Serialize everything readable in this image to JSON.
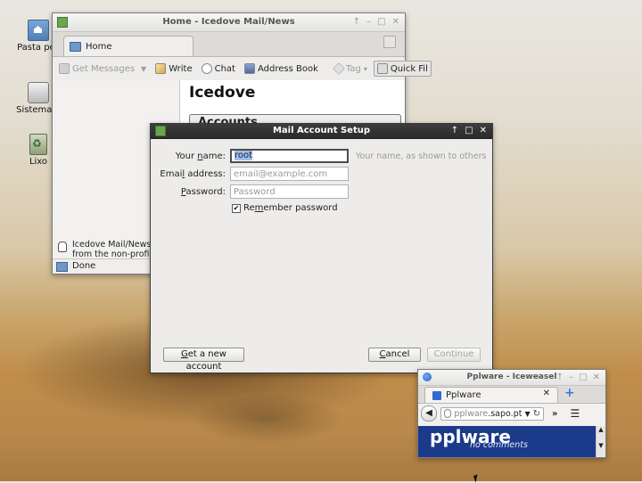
{
  "desktop": {
    "icons": [
      {
        "label": "Pasta pes",
        "icon": "home-folder-icon"
      },
      {
        "label": "Sistema d",
        "icon": "drive-icon"
      },
      {
        "label": "Lixo",
        "icon": "trash-icon"
      }
    ]
  },
  "icedove_window": {
    "title": "Home - Icedove Mail/News",
    "tab_label": "Home",
    "toolbar": {
      "get_messages": "Get Messages",
      "write": "Write",
      "chat": "Chat",
      "address_book": "Address Book",
      "tag": "Tag",
      "quick_filter": "Quick Fil"
    },
    "content_heading": "Icedove",
    "accounts_heading": "Accounts",
    "notice_line1": "Icedove Mail/News",
    "notice_line2": "from the non-profit",
    "status": "Done"
  },
  "dialog": {
    "title": "Mail Account Setup",
    "name_label": "Your name:",
    "name_value": "root",
    "name_hint": "Your name, as shown to others",
    "email_label": "Email address:",
    "email_placeholder": "email@example.com",
    "password_label": "Password:",
    "password_placeholder": "Password",
    "remember_label": "Remember password",
    "remember_checked": true,
    "get_account_button": "Get a new account",
    "cancel_button": "Cancel",
    "continue_button": "Continue"
  },
  "iceweasel_window": {
    "title": "Pplware - Iceweasel",
    "tab_label": "Pplware",
    "url_host": "pplware",
    "url_domain": ".sapo.pt",
    "logo_text": "pplware",
    "logo_subtitle": "no comments"
  }
}
